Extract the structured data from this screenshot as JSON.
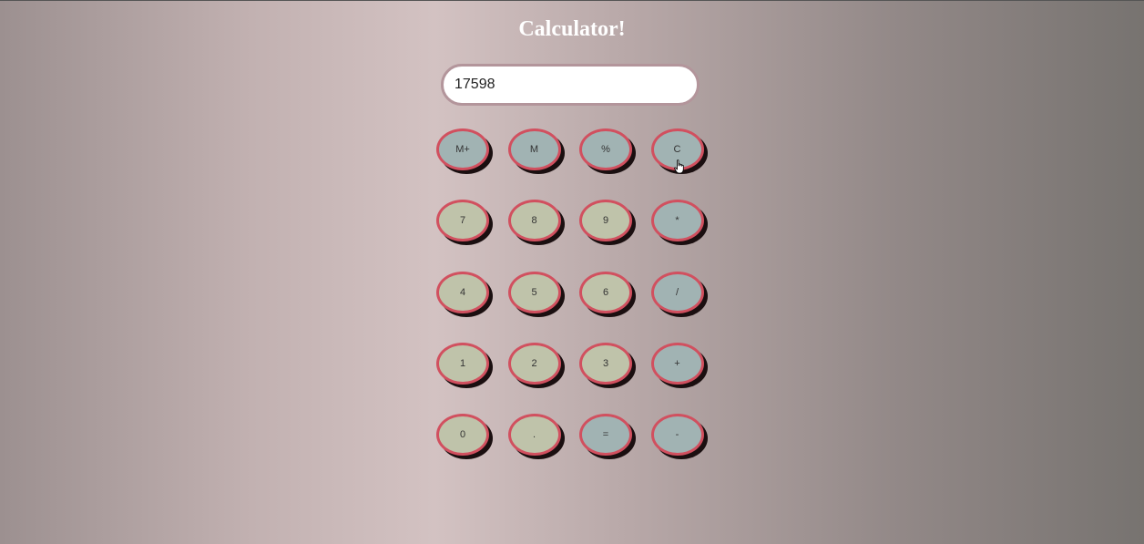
{
  "header": {
    "title": "Calculator!"
  },
  "display": {
    "value": "17598"
  },
  "colors": {
    "digit_key": "#bfc3aa",
    "operator_key": "#a1b3b3",
    "key_border": "#d1505f",
    "display_border": "#b3959b"
  },
  "keys": [
    {
      "label": "M+",
      "kind": "op"
    },
    {
      "label": "M",
      "kind": "op"
    },
    {
      "label": "%",
      "kind": "op"
    },
    {
      "label": "C",
      "kind": "op"
    },
    {
      "label": "7",
      "kind": "digit"
    },
    {
      "label": "8",
      "kind": "digit"
    },
    {
      "label": "9",
      "kind": "digit"
    },
    {
      "label": "*",
      "kind": "op"
    },
    {
      "label": "4",
      "kind": "digit"
    },
    {
      "label": "5",
      "kind": "digit"
    },
    {
      "label": "6",
      "kind": "digit"
    },
    {
      "label": "/",
      "kind": "op"
    },
    {
      "label": "1",
      "kind": "digit"
    },
    {
      "label": "2",
      "kind": "digit"
    },
    {
      "label": "3",
      "kind": "digit"
    },
    {
      "label": "+",
      "kind": "op"
    },
    {
      "label": "0",
      "kind": "digit"
    },
    {
      "label": ".",
      "kind": "digit"
    },
    {
      "label": "=",
      "kind": "op"
    },
    {
      "label": "-",
      "kind": "op"
    }
  ],
  "cursor": {
    "icon": "hand-pointer-icon"
  }
}
